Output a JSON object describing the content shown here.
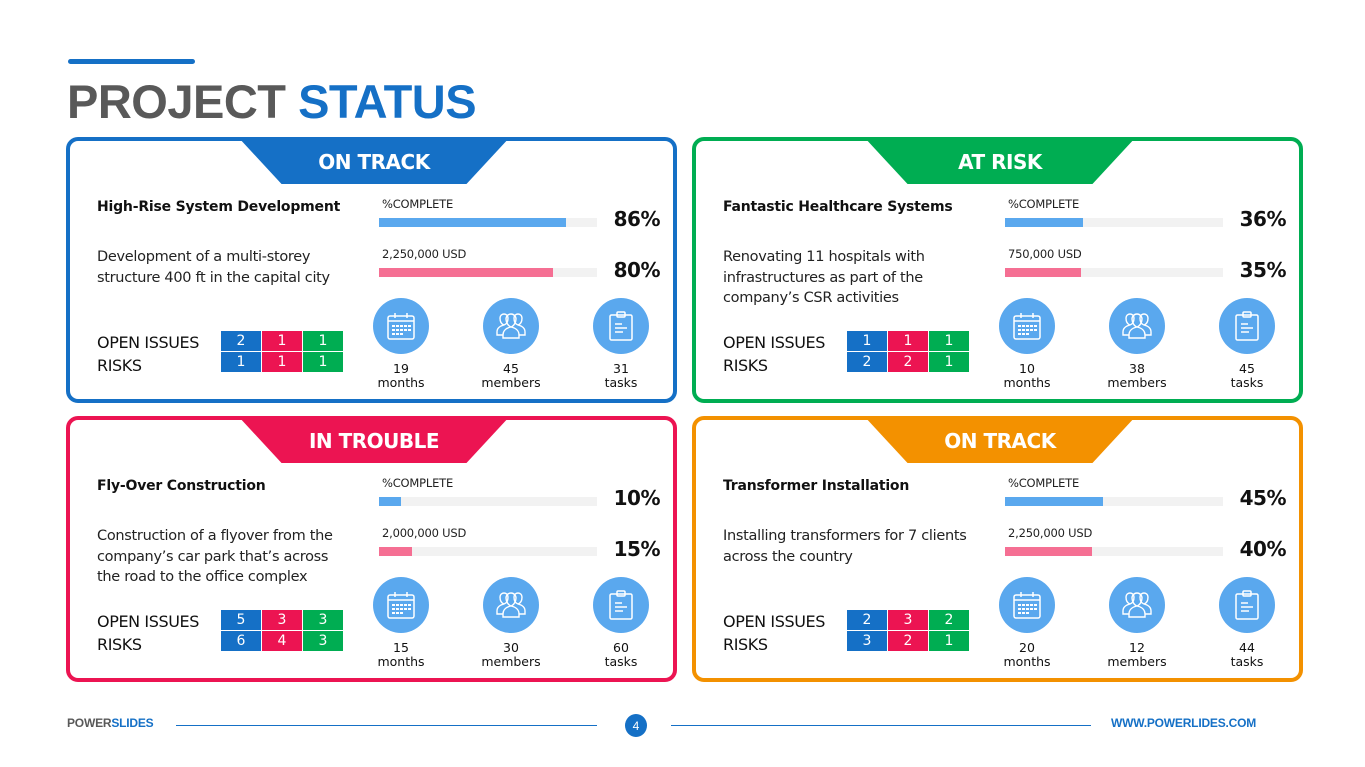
{
  "header": {
    "title_part1": "PROJECT",
    "title_part2": "STATUS"
  },
  "colors": {
    "blue": "#1570c6",
    "green": "#00ad52",
    "red": "#ec1452",
    "orange": "#f39100",
    "bar_complete": "#5aa8ee",
    "bar_budget": "#f56f93"
  },
  "cards": [
    {
      "status": "ON TRACK",
      "status_color": "#1570c6",
      "title": "High-Rise System Development",
      "description": "Development of a multi-storey structure 400 ft in the capital city",
      "complete_label": "%COMPLETE",
      "complete_value": 86,
      "complete_text": "86%",
      "budget_label": "2,250,000 USD",
      "budget_value": 80,
      "budget_text": "80%",
      "open_issues_label": "OPEN ISSUES",
      "risks_label": "RISKS",
      "open_issues": [
        "2",
        "1",
        "1"
      ],
      "risks": [
        "1",
        "1",
        "1"
      ],
      "stats": [
        {
          "icon": "calendar-icon",
          "value": "19",
          "unit": "months"
        },
        {
          "icon": "team-icon",
          "value": "45",
          "unit": "members"
        },
        {
          "icon": "clipboard-icon",
          "value": "31",
          "unit": "tasks"
        }
      ]
    },
    {
      "status": "AT RISK",
      "status_color": "#00ad52",
      "title": "Fantastic Healthcare Systems",
      "description": "Renovating 11 hospitals with infrastructures as part of the company’s CSR activities",
      "complete_label": "%COMPLETE",
      "complete_value": 36,
      "complete_text": "36%",
      "budget_label": "750,000 USD",
      "budget_value": 35,
      "budget_text": "35%",
      "open_issues_label": "OPEN ISSUES",
      "risks_label": "RISKS",
      "open_issues": [
        "1",
        "1",
        "1"
      ],
      "risks": [
        "2",
        "2",
        "1"
      ],
      "stats": [
        {
          "icon": "calendar-icon",
          "value": "10",
          "unit": "months"
        },
        {
          "icon": "team-icon",
          "value": "38",
          "unit": "members"
        },
        {
          "icon": "clipboard-icon",
          "value": "45",
          "unit": "tasks"
        }
      ]
    },
    {
      "status": "IN TROUBLE",
      "status_color": "#ec1452",
      "title": "Fly-Over Construction",
      "description": "Construction of a flyover from the company’s car park that’s across the road to the office complex",
      "complete_label": "%COMPLETE",
      "complete_value": 10,
      "complete_text": "10%",
      "budget_label": "2,000,000 USD",
      "budget_value": 15,
      "budget_text": "15%",
      "open_issues_label": "OPEN ISSUES",
      "risks_label": "RISKS",
      "open_issues": [
        "5",
        "3",
        "3"
      ],
      "risks": [
        "6",
        "4",
        "3"
      ],
      "stats": [
        {
          "icon": "calendar-icon",
          "value": "15",
          "unit": "months"
        },
        {
          "icon": "team-icon",
          "value": "30",
          "unit": "members"
        },
        {
          "icon": "clipboard-icon",
          "value": "60",
          "unit": "tasks"
        }
      ]
    },
    {
      "status": "ON TRACK",
      "status_color": "#f39100",
      "title": "Transformer Installation",
      "description": "Installing transformers for 7 clients across the country",
      "complete_label": "%COMPLETE",
      "complete_value": 45,
      "complete_text": "45%",
      "budget_label": "2,250,000 USD",
      "budget_value": 40,
      "budget_text": "40%",
      "open_issues_label": "OPEN ISSUES",
      "risks_label": "RISKS",
      "open_issues": [
        "2",
        "3",
        "2"
      ],
      "risks": [
        "3",
        "2",
        "1"
      ],
      "stats": [
        {
          "icon": "calendar-icon",
          "value": "20",
          "unit": "months"
        },
        {
          "icon": "team-icon",
          "value": "12",
          "unit": "members"
        },
        {
          "icon": "clipboard-icon",
          "value": "44",
          "unit": "tasks"
        }
      ]
    }
  ],
  "footer": {
    "brand_part1": "POWER",
    "brand_part2": "SLIDES",
    "page_number": "4",
    "website": "WWW.POWERLIDES.COM"
  }
}
